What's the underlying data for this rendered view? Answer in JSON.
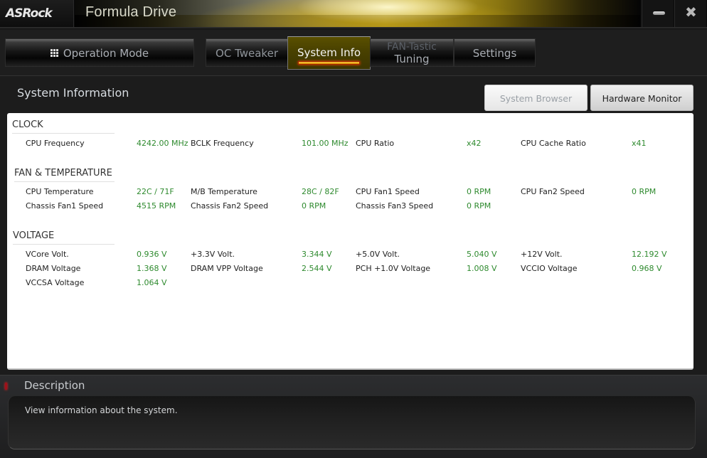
{
  "window": {
    "brand": "ASRock",
    "title": "Formula Drive",
    "minimize_icon": "minimize-icon",
    "close_icon": "close-icon"
  },
  "nav": {
    "operation_mode": {
      "label": "Operation Mode",
      "icon": "grid-icon"
    },
    "tabs": [
      {
        "label": "OC Tweaker",
        "active": false
      },
      {
        "label": "System Info",
        "active": true
      },
      {
        "label_line1": "FAN-Tastic",
        "label_line2": "Tuning",
        "active": false
      },
      {
        "label": "Settings",
        "active": false
      }
    ]
  },
  "section": {
    "title": "System Information",
    "buttons": {
      "system_browser": "System Browser",
      "hardware_monitor": "Hardware Monitor"
    }
  },
  "groups": {
    "clock": {
      "title": "CLOCK",
      "rows": [
        [
          {
            "label": "CPU Frequency",
            "value": "4242.00 MHz"
          },
          {
            "label": "BCLK Frequency",
            "value": "101.00 MHz"
          },
          {
            "label": "CPU Ratio",
            "value": "x42"
          },
          {
            "label": "CPU Cache Ratio",
            "value": "x41"
          }
        ]
      ]
    },
    "fan_temp": {
      "title": "FAN & TEMPERATURE",
      "rows": [
        [
          {
            "label": "CPU Temperature",
            "value": "22C / 71F"
          },
          {
            "label": "M/B Temperature",
            "value": "28C / 82F"
          },
          {
            "label": "CPU Fan1 Speed",
            "value": "0 RPM"
          },
          {
            "label": "CPU Fan2 Speed",
            "value": "0 RPM"
          }
        ],
        [
          {
            "label": "Chassis Fan1 Speed",
            "value": "4515 RPM"
          },
          {
            "label": "Chassis Fan2 Speed",
            "value": "0 RPM"
          },
          {
            "label": "Chassis Fan3 Speed",
            "value": "0 RPM"
          }
        ]
      ]
    },
    "voltage": {
      "title": "VOLTAGE",
      "rows": [
        [
          {
            "label": "VCore Volt.",
            "value": "0.936 V"
          },
          {
            "label": "+3.3V Volt.",
            "value": "3.344 V"
          },
          {
            "label": "+5.0V Volt.",
            "value": "5.040 V"
          },
          {
            "label": "+12V Volt.",
            "value": "12.192 V"
          }
        ],
        [
          {
            "label": "DRAM Voltage",
            "value": "1.368 V"
          },
          {
            "label": "DRAM VPP Voltage",
            "value": "2.544 V"
          },
          {
            "label": "PCH +1.0V Voltage",
            "value": "1.008 V"
          },
          {
            "label": "VCCIO Voltage",
            "value": "0.968 V"
          }
        ],
        [
          {
            "label": "VCCSA Voltage",
            "value": "1.064 V"
          }
        ]
      ]
    }
  },
  "description": {
    "title": "Description",
    "text": "View information about the system."
  },
  "colors": {
    "value_green": "#2e8a2e",
    "active_tab": "#4a4200",
    "accent_orange": "#ffcc40"
  }
}
